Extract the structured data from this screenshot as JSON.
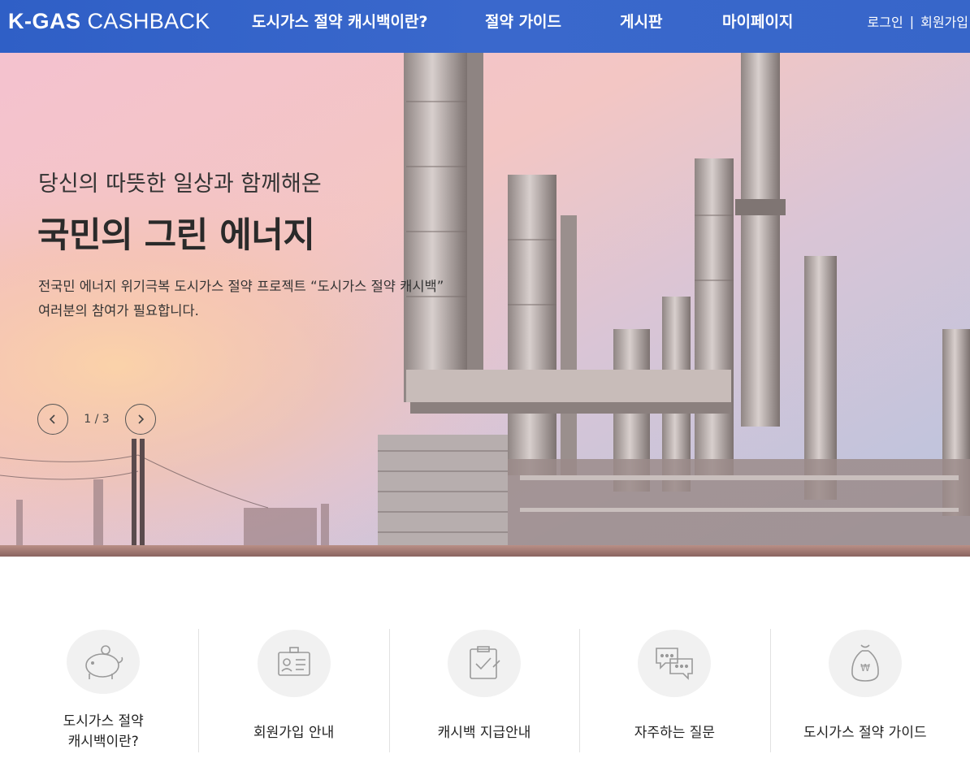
{
  "header": {
    "logo_strong": "K-GAS",
    "logo_light": "CASHBACK",
    "nav": [
      {
        "label": "도시가스 절약 캐시백이란?"
      },
      {
        "label": "절약 가이드"
      },
      {
        "label": "게시판"
      },
      {
        "label": "마이페이지"
      }
    ],
    "login": "로그인",
    "separator": "|",
    "signup": "회원가입",
    "bg_color": "#3463c8"
  },
  "hero": {
    "subtitle": "당신의 따뜻한 일상과 함께해온",
    "title": "국민의 그린 에너지",
    "desc_line1": "전국민 에너지 위기극복 도시가스 절약 프로젝트 “도시가스 절약 캐시백”",
    "desc_line2": "여러분의 참여가 필요합니다.",
    "pager": "1 / 3",
    "prev_icon": "chevron-left-icon",
    "next_icon": "chevron-right-icon"
  },
  "quick_menu": [
    {
      "label": "도시가스 절약\n캐시백이란?",
      "icon": "piggy-bank-icon"
    },
    {
      "label": "회원가입 안내",
      "icon": "id-card-icon"
    },
    {
      "label": "캐시백 지급안내",
      "icon": "clipboard-check-icon"
    },
    {
      "label": "자주하는 질문",
      "icon": "speech-bubbles-icon"
    },
    {
      "label": "도시가스 절약 가이드",
      "icon": "money-bag-icon"
    }
  ]
}
